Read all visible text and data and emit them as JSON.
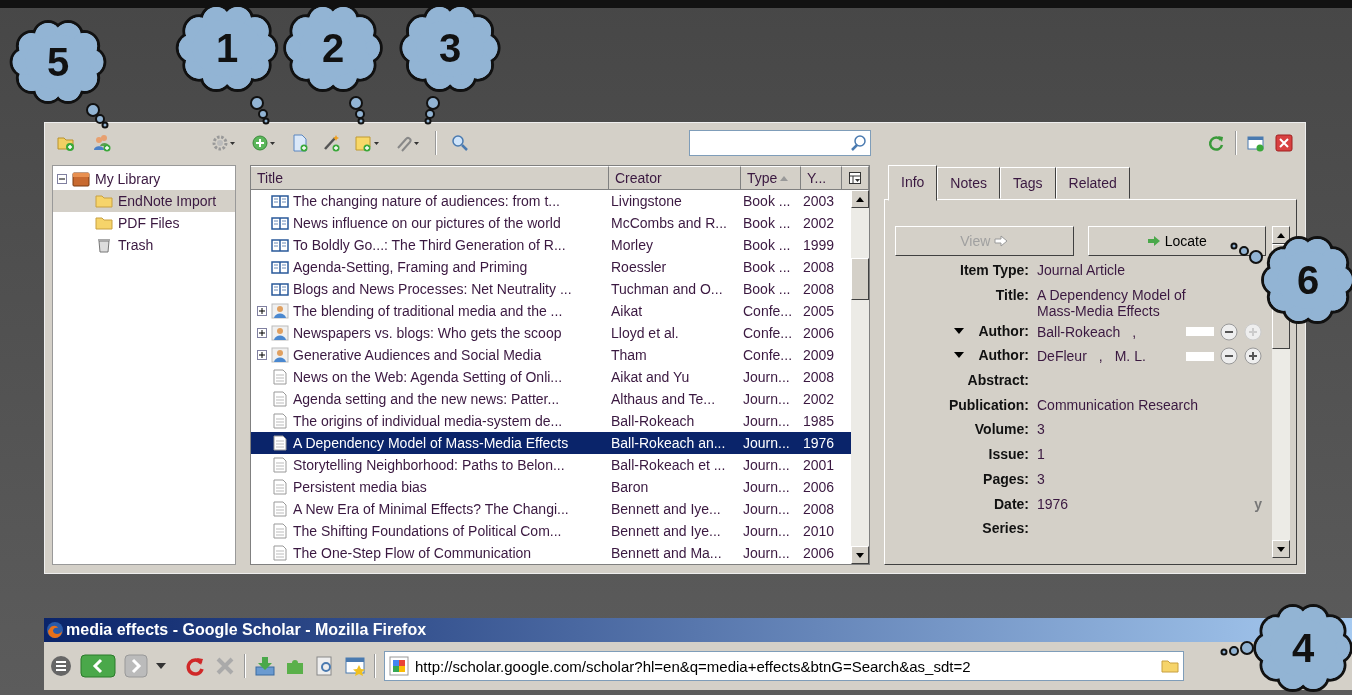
{
  "callouts": [
    {
      "label": "5"
    },
    {
      "label": "1"
    },
    {
      "label": "2"
    },
    {
      "label": "3"
    },
    {
      "label": "6"
    },
    {
      "label": "4"
    }
  ],
  "zotero": {
    "collections": [
      {
        "kind": "library",
        "label": "My Library",
        "expanded": true,
        "selected": false,
        "children": [
          {
            "kind": "folder",
            "label": "EndNote Import",
            "selected": true
          },
          {
            "kind": "folder",
            "label": "PDF Files",
            "selected": false
          },
          {
            "kind": "trash",
            "label": "Trash",
            "selected": false
          }
        ]
      }
    ],
    "columns": [
      {
        "label": "Title",
        "sorted": false
      },
      {
        "label": "Creator",
        "sorted": false
      },
      {
        "label": "Type",
        "sorted": true
      },
      {
        "label": "Y...",
        "sorted": false
      }
    ],
    "rows": [
      {
        "kind": "book",
        "expandable": false,
        "selected": false,
        "title": "The changing nature of audiences: from t...",
        "creator": "Livingstone",
        "type": "Book ...",
        "year": "2003"
      },
      {
        "kind": "book",
        "expandable": false,
        "selected": false,
        "title": "News influence on our pictures of the world",
        "creator": "McCombs and R...",
        "type": "Book ...",
        "year": "2002"
      },
      {
        "kind": "book",
        "expandable": false,
        "selected": false,
        "title": "To Boldly Go...: The Third Generation of R...",
        "creator": "Morley",
        "type": "Book ...",
        "year": "1999"
      },
      {
        "kind": "book",
        "expandable": false,
        "selected": false,
        "title": "Agenda-Setting, Framing and Priming",
        "creator": "Roessler",
        "type": "Book ...",
        "year": "2008"
      },
      {
        "kind": "book",
        "expandable": false,
        "selected": false,
        "title": "Blogs and News Processes: Net Neutrality ...",
        "creator": "Tuchman and O...",
        "type": "Book ...",
        "year": "2008"
      },
      {
        "kind": "conference",
        "expandable": true,
        "selected": false,
        "title": "The blending of traditional media and the ...",
        "creator": "Aikat",
        "type": "Confe...",
        "year": "2005"
      },
      {
        "kind": "conference",
        "expandable": true,
        "selected": false,
        "title": "Newspapers vs. blogs: Who gets the scoop",
        "creator": "Lloyd et al.",
        "type": "Confe...",
        "year": "2006"
      },
      {
        "kind": "conference",
        "expandable": true,
        "selected": false,
        "title": "Generative Audiences and Social Media",
        "creator": "Tham",
        "type": "Confe...",
        "year": "2009"
      },
      {
        "kind": "journal",
        "expandable": false,
        "selected": false,
        "title": "News on the Web: Agenda Setting of Onli...",
        "creator": "Aikat and Yu",
        "type": "Journ...",
        "year": "2008"
      },
      {
        "kind": "journal",
        "expandable": false,
        "selected": false,
        "title": "Agenda setting and the new news: Patter...",
        "creator": "Althaus and Te...",
        "type": "Journ...",
        "year": "2002"
      },
      {
        "kind": "journal",
        "expandable": false,
        "selected": false,
        "title": "The origins of individual media-system de...",
        "creator": "Ball-Rokeach",
        "type": "Journ...",
        "year": "1985"
      },
      {
        "kind": "journal",
        "expandable": false,
        "selected": true,
        "title": "A Dependency Model of Mass-Media Effects",
        "creator": "Ball-Rokeach an...",
        "type": "Journ...",
        "year": "1976"
      },
      {
        "kind": "journal",
        "expandable": false,
        "selected": false,
        "title": "Storytelling Neighborhood: Paths to Belon...",
        "creator": "Ball-Rokeach et ...",
        "type": "Journ...",
        "year": "2001"
      },
      {
        "kind": "journal",
        "expandable": false,
        "selected": false,
        "title": "Persistent media bias",
        "creator": "Baron",
        "type": "Journ...",
        "year": "2006"
      },
      {
        "kind": "journal",
        "expandable": false,
        "selected": false,
        "title": "A New Era of Minimal Effects? The Changi...",
        "creator": "Bennett and Iye...",
        "type": "Journ...",
        "year": "2008"
      },
      {
        "kind": "journal",
        "expandable": false,
        "selected": false,
        "title": "The Shifting Foundations of Political Com...",
        "creator": "Bennett and Iye...",
        "type": "Journ...",
        "year": "2010"
      },
      {
        "kind": "journal",
        "expandable": false,
        "selected": false,
        "title": "The One-Step Flow of Communication",
        "creator": "Bennett and Ma...",
        "type": "Journ...",
        "year": "2006"
      }
    ],
    "tabs": [
      {
        "label": "Info",
        "selected": true
      },
      {
        "label": "Notes",
        "selected": false
      },
      {
        "label": "Tags",
        "selected": false
      },
      {
        "label": "Related",
        "selected": false
      }
    ],
    "buttons": [
      {
        "kind": "view",
        "label": "View",
        "disabled": true
      },
      {
        "kind": "locate",
        "label": "Locate",
        "disabled": false
      }
    ],
    "fields": [
      {
        "kind": "text",
        "label": "Item Type:",
        "value": "Journal Article"
      },
      {
        "kind": "text",
        "label": "Title:",
        "value": "A Dependency Model of Mass-Media Effects"
      },
      {
        "kind": "creator",
        "label": "Author:",
        "last": "Ball-Rokeach",
        "comma": ",",
        "can_add": false
      },
      {
        "kind": "creator",
        "label": "Author:",
        "last": "DeFleur",
        "comma": ",",
        "first": "M. L.",
        "can_add": true
      },
      {
        "kind": "text",
        "label": "Abstract:"
      },
      {
        "kind": "text",
        "label": "Publication:",
        "value": "Communication Research"
      },
      {
        "kind": "text",
        "label": "Volume:",
        "value": "3"
      },
      {
        "kind": "text",
        "label": "Issue:",
        "value": "1"
      },
      {
        "kind": "text",
        "label": "Pages:",
        "value": "3"
      },
      {
        "kind": "text",
        "label": "Date:",
        "value": "1976",
        "suffix": "y"
      },
      {
        "kind": "text",
        "label": "Series:"
      }
    ]
  },
  "firefox": {
    "title": "media effects - Google Scholar - Mozilla Firefox",
    "url": "http://scholar.google.com/scholar?hl=en&q=media+effects&btnG=Search&as_sdt=2"
  }
}
